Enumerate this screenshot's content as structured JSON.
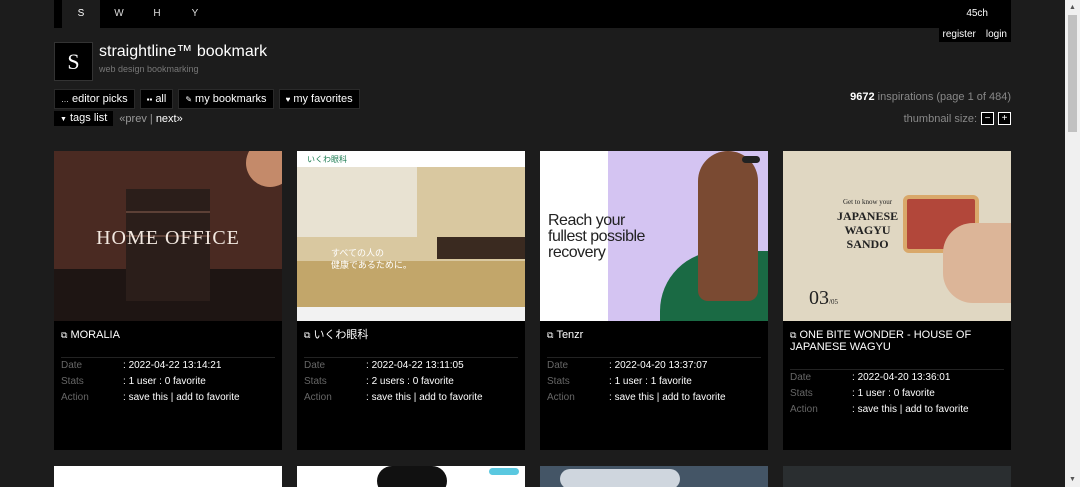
{
  "topbar": {
    "tabs": [
      {
        "label": "S",
        "active": true
      },
      {
        "label": "W",
        "active": false
      },
      {
        "label": "H",
        "active": false
      },
      {
        "label": "Y",
        "active": false
      }
    ],
    "channel": "45ch"
  },
  "auth": {
    "register": "register",
    "login": "login"
  },
  "site": {
    "logo_letter": "S",
    "title": "straightline™  bookmark",
    "subtitle": "web design bookmarking"
  },
  "filters": [
    {
      "icon": "editor-icon",
      "label": "editor picks"
    },
    {
      "icon": "grid-icon",
      "label": "all"
    },
    {
      "icon": "pencil-icon",
      "label": "my bookmarks"
    },
    {
      "icon": "heart-icon",
      "label": "my favorites"
    }
  ],
  "stats": {
    "count": "9672",
    "text": " inspirations (page 1 of 484)"
  },
  "tags": {
    "label": "tags list"
  },
  "pager": {
    "prev": "«prev",
    "sep": " | ",
    "next": "next»"
  },
  "thumb_size": {
    "label": "thumbnail size:",
    "minus": "−",
    "plus": "+"
  },
  "cards": [
    {
      "title": "MORALIA",
      "art_text": "HOME OFFICE",
      "date": "2022-04-22 13:14:21",
      "stats": "1 user : 0 favorite",
      "save": "save this",
      "fav": "add to favorite"
    },
    {
      "title": "いくわ眼科",
      "art_logo": "いくわ眼科",
      "art_text1": "すべての人の",
      "art_text2": "健康であるために。",
      "date": "2022-04-22 13:11:05",
      "stats": "2 users : 0 favorite",
      "save": "save this",
      "fav": "add to favorite"
    },
    {
      "title": "Tenzr",
      "art_text1": "Reach your",
      "art_text2": "fullest possible",
      "art_text3": "recovery",
      "date": "2022-04-20 13:37:07",
      "stats": "1 user : 1 favorite",
      "save": "save this",
      "fav": "add to favorite"
    },
    {
      "title": "ONE BITE WONDER - HOUSE OF JAPANESE WAGYU",
      "art_small": "Get to know your",
      "art_l1": "JAPANESE",
      "art_l2": "WAGYU",
      "art_l3": "SANDO",
      "art_num": "03",
      "art_den": "/05",
      "date": "2022-04-20 13:36:01",
      "stats": "1 user : 0 favorite",
      "save": "save this",
      "fav": "add to favorite"
    }
  ],
  "labels": {
    "date": "Date",
    "stats": "Stats",
    "action": "Action",
    "colon": ": ",
    "bar": " | "
  }
}
